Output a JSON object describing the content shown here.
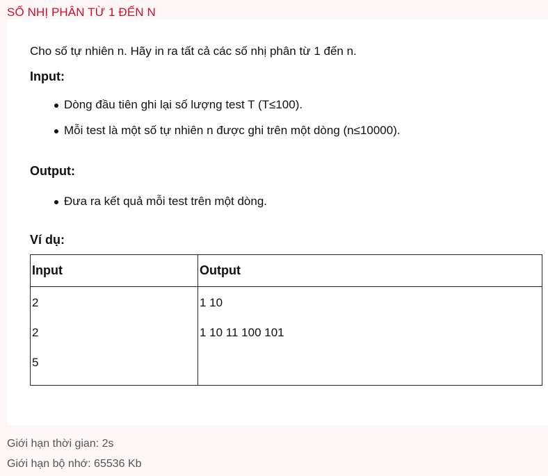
{
  "problem": {
    "title": "SỐ NHỊ PHÂN TỪ 1 ĐẾN N",
    "description": "Cho số tự nhiên n. Hãy in ra tất cả các số nhị phân từ 1 đến n.",
    "input_heading": "Input:",
    "input_items": [
      "Dòng đầu tiên ghi lại số lượng test T (T≤100).",
      "Mỗi test là một số tự nhiên n được ghi trên một dòng (n≤10000)."
    ],
    "output_heading": "Output:",
    "output_items": [
      "Đưa ra kết quả mỗi test trên một dòng."
    ],
    "example_heading": "Ví dụ:",
    "example_table": {
      "headers": [
        "Input",
        "Output"
      ],
      "input_lines": [
        "2",
        "2",
        "5"
      ],
      "output_lines": [
        "1 10",
        "1 10 11 100 101"
      ]
    }
  },
  "limits": {
    "time": "Giới hạn thời gian: 2s",
    "memory": "Giới hạn bộ nhớ: 65536 Kb"
  },
  "colors": {
    "title": "#c8102e",
    "page_background": "#fcf7f6",
    "card_background": "#fefefe",
    "limits_text": "#555555"
  }
}
